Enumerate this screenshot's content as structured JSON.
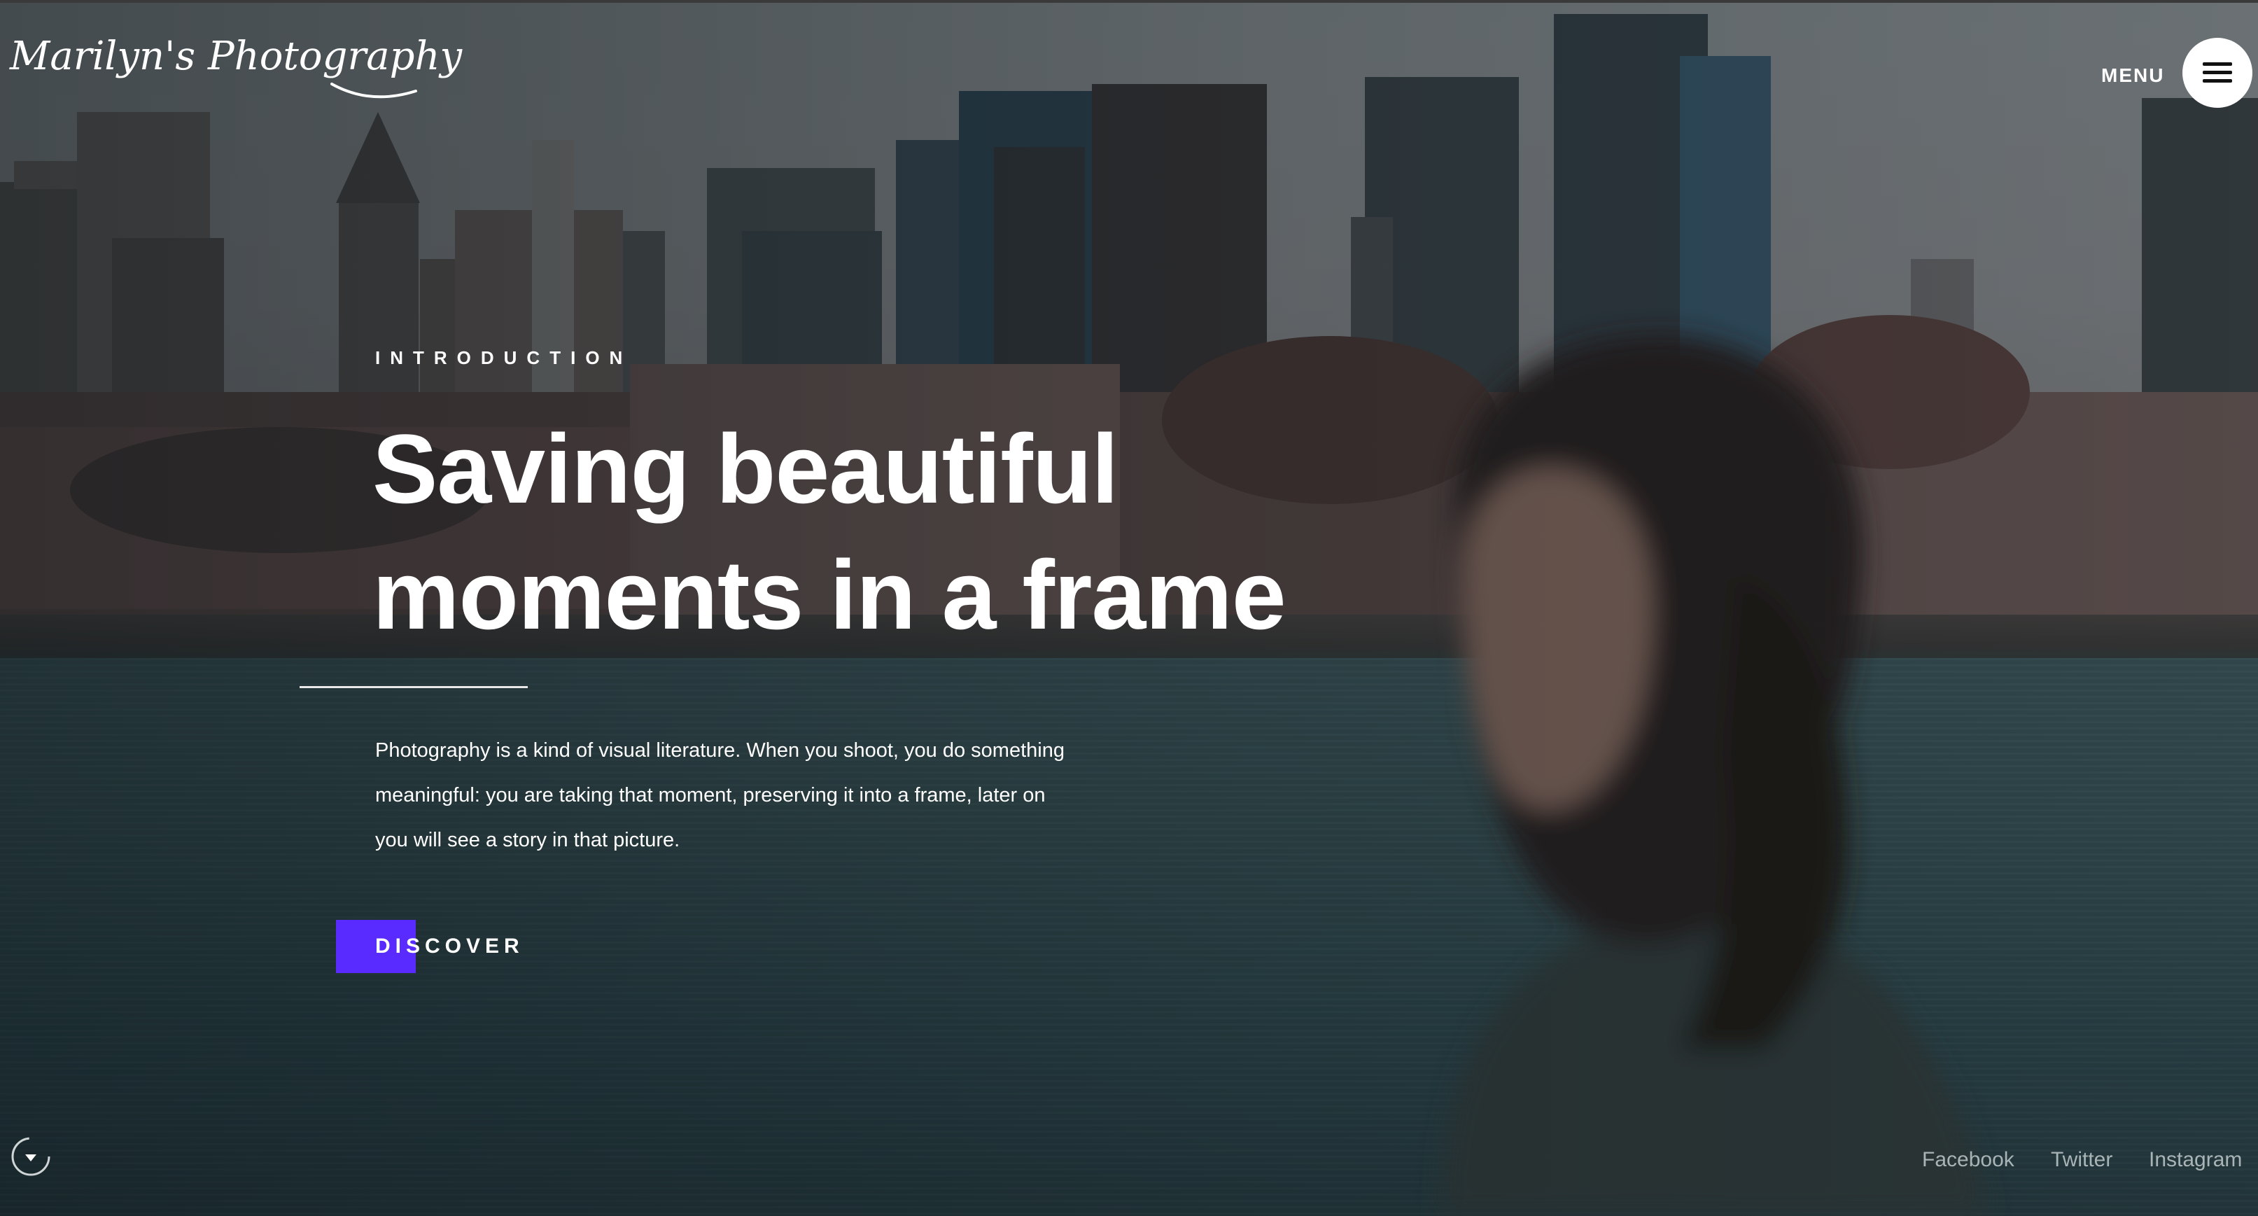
{
  "header": {
    "logo_text": "Marilyn's Photography",
    "menu_label": "MENU",
    "menu_icon": "hamburger-menu-icon"
  },
  "hero": {
    "eyebrow": "INTRODUCTION",
    "headline_line1": "Saving beautiful",
    "headline_line2": "moments in a frame",
    "lede_line1": "Photography is a kind of visual literature. When you shoot, you do something",
    "lede_line2": "meaningful: you are taking that moment, preserving it into a frame, later on",
    "lede_line3": "you will see a story in that picture.",
    "cta_label": "DISCOVER"
  },
  "footer": {
    "scroll_icon": "scroll-down-icon",
    "social": [
      {
        "label": "Facebook"
      },
      {
        "label": "Twitter"
      },
      {
        "label": "Instagram"
      }
    ]
  },
  "colors": {
    "accent": "#5a2bff",
    "text": "#ffffff",
    "social_text": "#a9b4b6"
  }
}
